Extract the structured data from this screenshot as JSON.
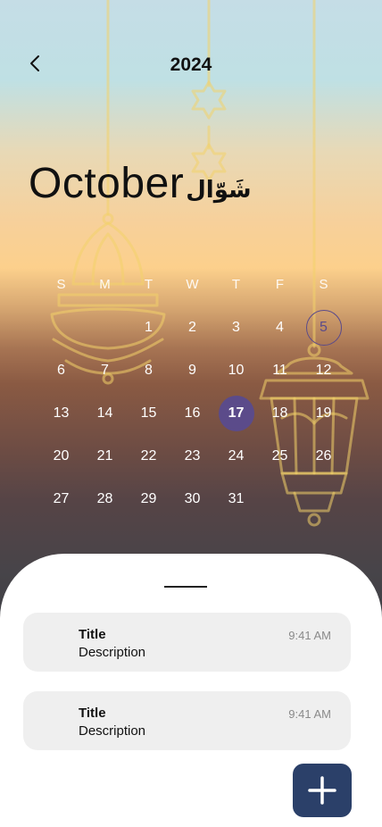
{
  "header": {
    "year": "2024",
    "month": "October",
    "hijri_month": "شَوّال"
  },
  "calendar": {
    "weekdays": [
      "S",
      "M",
      "T",
      "W",
      "T",
      "F",
      "S"
    ],
    "leading_blanks": 2,
    "days": [
      1,
      2,
      3,
      4,
      5,
      6,
      7,
      8,
      9,
      10,
      11,
      12,
      13,
      14,
      15,
      16,
      17,
      18,
      19,
      20,
      21,
      22,
      23,
      24,
      25,
      26,
      27,
      28,
      29,
      30,
      31
    ],
    "selected_day": 17,
    "outlined_day": 5
  },
  "events": [
    {
      "title": "Title",
      "description": "Description",
      "time": "9:41 AM"
    },
    {
      "title": "Title",
      "description": "Description",
      "time": "9:41 AM"
    }
  ],
  "icons": {
    "back": "chevron-left-icon",
    "add": "plus-icon"
  },
  "colors": {
    "selected": "#5b4b8a",
    "fab": "#2b4069",
    "lantern": "#f2d26a"
  }
}
